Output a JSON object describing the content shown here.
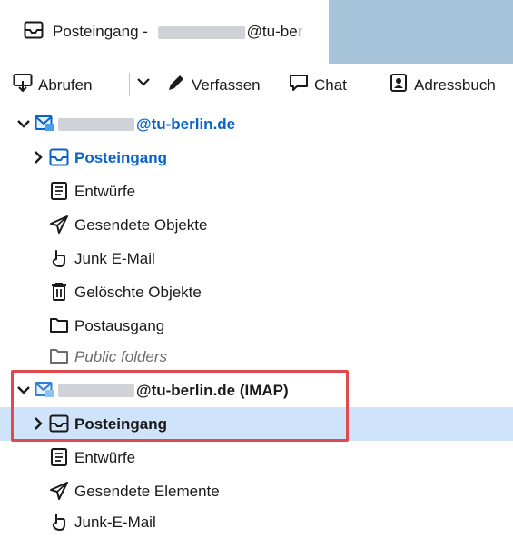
{
  "tab": {
    "title_prefix": "Posteingang - ",
    "title_suffix": "@tu-be",
    "title_fade": "r"
  },
  "toolbar": {
    "abrufen": "Abrufen",
    "verfassen": "Verfassen",
    "chat": "Chat",
    "adressbuch": "Adressbuch"
  },
  "account1": {
    "name": "@tu-berlin.de",
    "folders": [
      {
        "label": "Posteingang",
        "icon": "inbox-icon"
      },
      {
        "label": "Entwürfe",
        "icon": "drafts-icon"
      },
      {
        "label": "Gesendete Objekte",
        "icon": "sent-icon"
      },
      {
        "label": "Junk E-Mail",
        "icon": "junk-icon"
      },
      {
        "label": "Gelöschte Objekte",
        "icon": "trash-icon"
      },
      {
        "label": "Postausgang",
        "icon": "folder-icon"
      },
      {
        "label": "Public folders",
        "icon": "folder-icon"
      }
    ]
  },
  "account2": {
    "name": "@tu-berlin.de (IMAP)",
    "folders": [
      {
        "label": "Posteingang",
        "icon": "inbox-icon"
      },
      {
        "label": "Entwürfe",
        "icon": "drafts-icon"
      },
      {
        "label": "Gesendete Elemente",
        "icon": "sent-icon"
      },
      {
        "label": "Junk-E-Mail",
        "icon": "junk-icon"
      }
    ]
  },
  "colors": {
    "accent": "#0a63c6",
    "selection": "#cfe3fb",
    "highlight_border": "#e0494d",
    "tabstrip": "#a8c4da"
  }
}
